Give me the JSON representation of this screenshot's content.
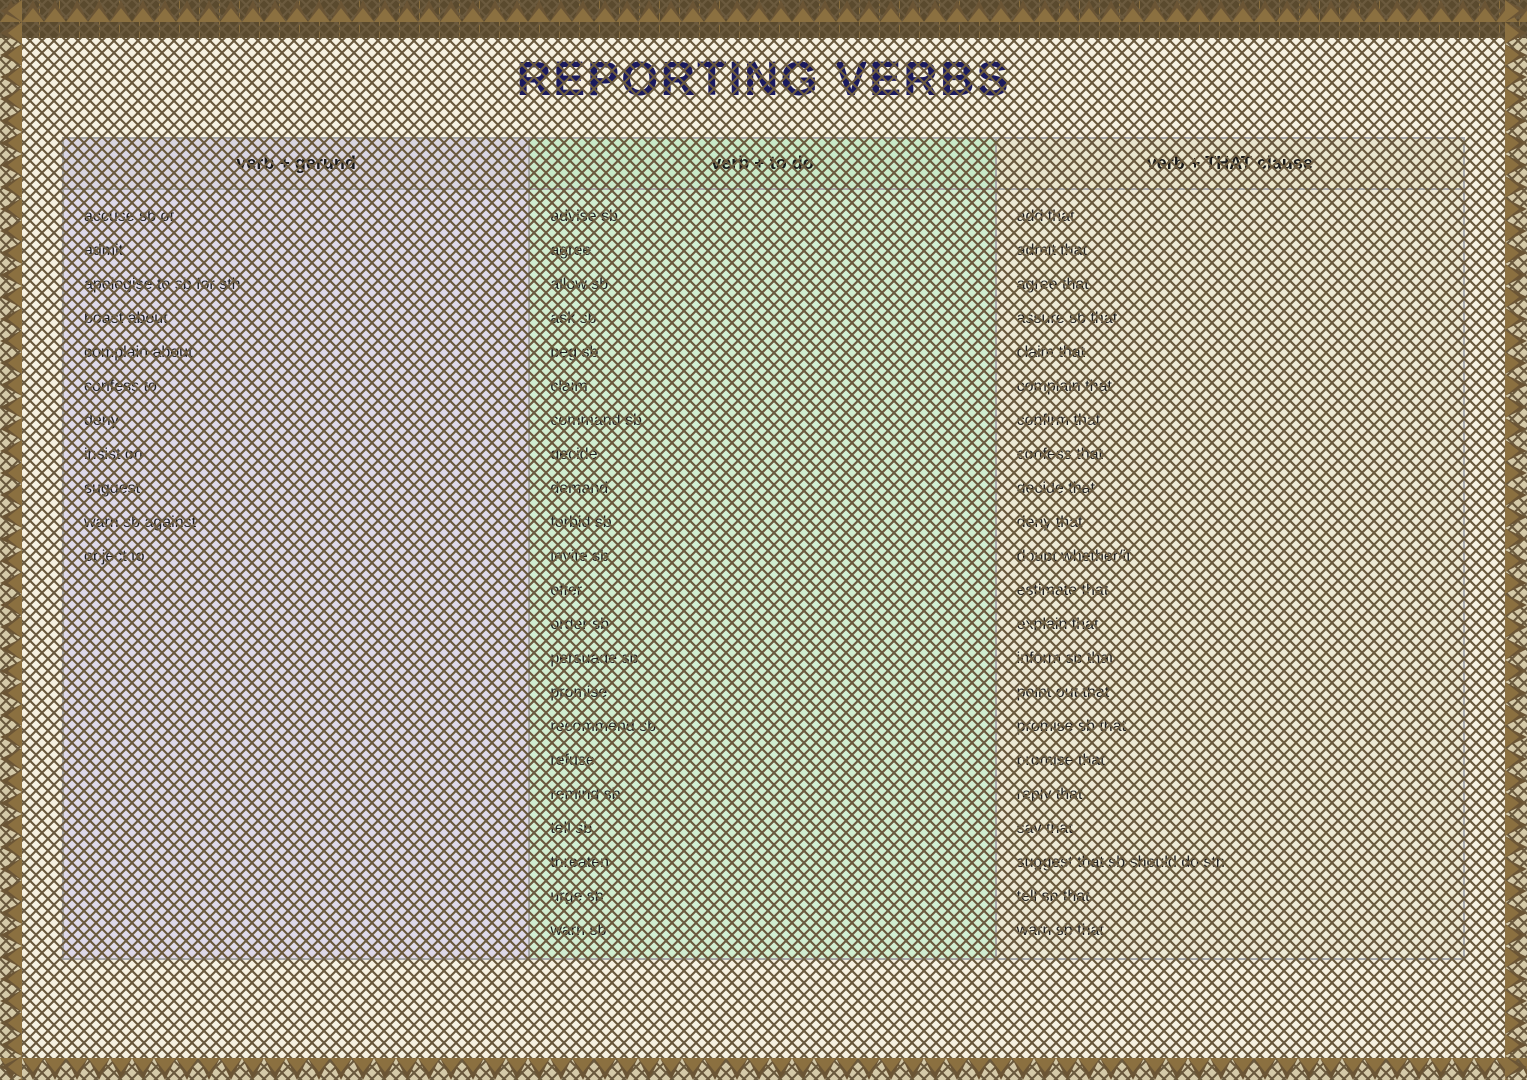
{
  "page": {
    "title": "REPORTING VERBS",
    "background_color": "#f5f0e0",
    "border_color": "#8b7040"
  },
  "columns": {
    "gerund": {
      "header": "verb + gerund",
      "items": [
        "accuse sb of",
        "admit",
        "apologise to sb for sth",
        "boast about",
        "complain about",
        "confess to",
        "deny",
        "insist on",
        "suggest",
        "warn sb against",
        "object to"
      ]
    },
    "todo": {
      "header": "verb + to do",
      "items": [
        "advise sb",
        "agree",
        "allow sb",
        "ask sb",
        "beg sb",
        "claim",
        "command sb",
        "decide",
        "demand",
        "forbid sb",
        "invite sb",
        "offer",
        "order sb",
        "persuade sb",
        "promise",
        "recommend sb",
        "refuse",
        "remind sb",
        "tell sb",
        "threaten",
        "urge sb",
        "warn sb"
      ]
    },
    "that": {
      "header": "verb + THAT clause",
      "items": [
        "add that",
        "admit that",
        "agree that",
        "assure sb that",
        "claim that",
        "complain that",
        "confirm that",
        "confess that",
        "decide that",
        "deny that",
        "doubt whether/if",
        "estimate that",
        "explain that",
        "inform sb that",
        "point out that",
        "promise sb that",
        "promise that",
        "reply that",
        "say that",
        "suggest that sb should do sth",
        "tell sb that",
        "warn sb that"
      ]
    }
  }
}
